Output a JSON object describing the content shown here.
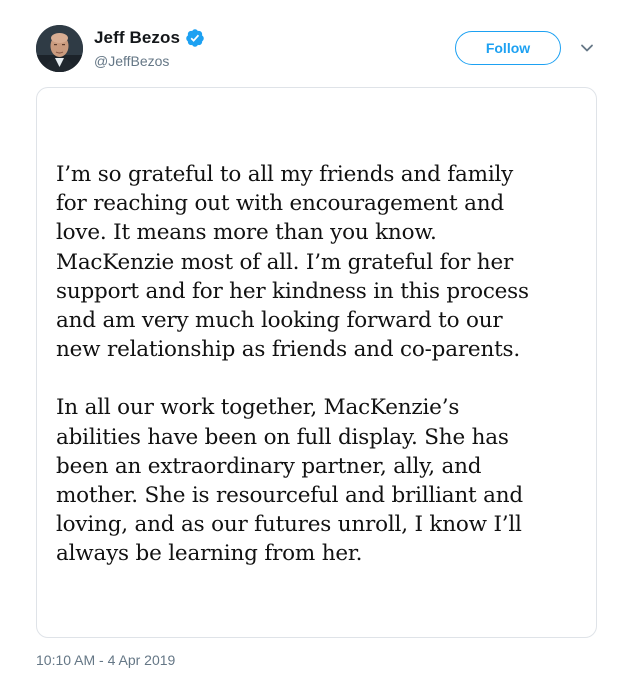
{
  "author": {
    "name": "Jeff Bezos",
    "handle": "@JeffBezos",
    "verified": true,
    "avatar_icon": "profile-photo"
  },
  "actions": {
    "follow_label": "Follow",
    "more_icon": "chevron-down-icon"
  },
  "image_card": {
    "paragraphs": [
      "I’m so grateful to all my friends and family\nfor reaching out with encouragement and\nlove. It means more than you know.\nMacKenzie most of all. I’m grateful for her\nsupport and for her kindness in this process\nand am very much looking forward to our\nnew relationship as friends and co-parents.",
      "In all our work together, MacKenzie’s\nabilities have been on full display. She has\nbeen an extraordinary partner, ally, and\nmother. She is resourceful and brilliant and\nloving, and as our futures unroll, I know I’ll\nalways be learning from her."
    ]
  },
  "meta": {
    "timestamp": "10:10 AM - 4 Apr 2019"
  },
  "colors": {
    "accent": "#1da1f2",
    "secondary_text": "#657786",
    "border": "#dfe3e8"
  }
}
